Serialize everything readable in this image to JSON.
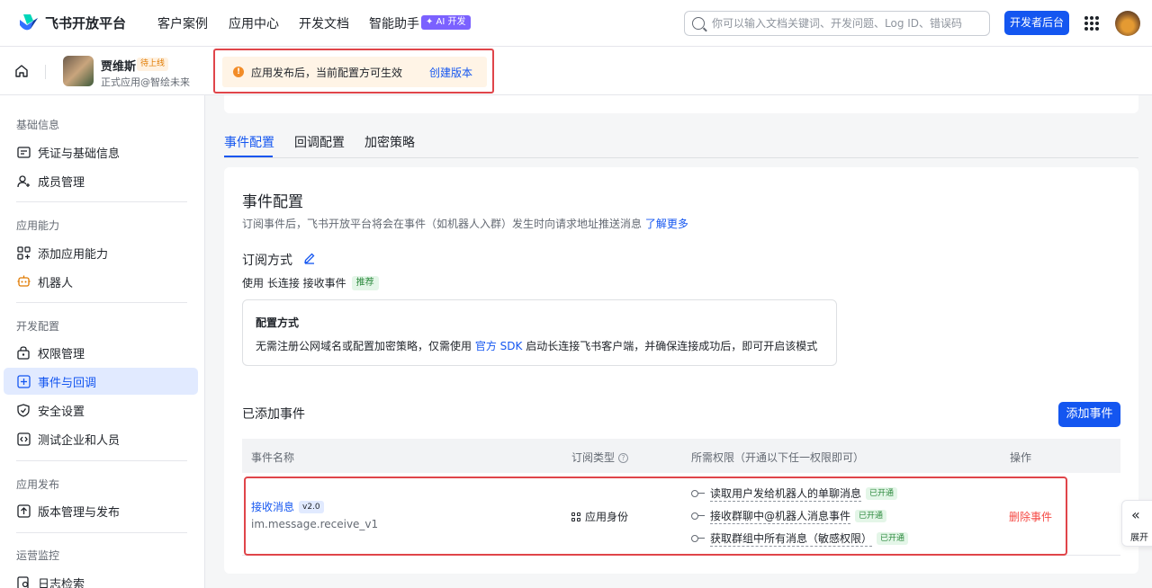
{
  "topnav": {
    "logo_text": "飞书开放平台",
    "items": [
      "客户案例",
      "应用中心",
      "开发文档",
      "智能助手"
    ],
    "ai_badge": "✦ AI 开发",
    "search_placeholder": "你可以输入文档关键词、开发问题、Log ID、错误码",
    "dev_console": "开发者后台"
  },
  "app": {
    "name": "贾维斯",
    "status": "待上线",
    "subtitle": "正式应用@智绘未来"
  },
  "notice": {
    "text": "应用发布后，当前配置方可生效",
    "link": "创建版本"
  },
  "sidebar": {
    "groups": [
      {
        "title": "基础信息",
        "items": [
          {
            "label": "凭证与基础信息",
            "icon": "id-card-icon"
          },
          {
            "label": "成员管理",
            "icon": "user-add-icon"
          }
        ]
      },
      {
        "title": "应用能力",
        "items": [
          {
            "label": "添加应用能力",
            "icon": "apps-add-icon"
          },
          {
            "label": "机器人",
            "icon": "robot-icon"
          }
        ]
      },
      {
        "title": "开发配置",
        "items": [
          {
            "label": "权限管理",
            "icon": "lock-icon"
          },
          {
            "label": "事件与回调",
            "icon": "event-icon"
          },
          {
            "label": "安全设置",
            "icon": "shield-icon"
          },
          {
            "label": "测试企业和人员",
            "icon": "code-icon"
          }
        ]
      },
      {
        "title": "应用发布",
        "items": [
          {
            "label": "版本管理与发布",
            "icon": "upload-icon"
          }
        ]
      },
      {
        "title": "运营监控",
        "items": [
          {
            "label": "日志检索",
            "icon": "search-doc-icon"
          }
        ]
      }
    ]
  },
  "tabs": [
    "事件配置",
    "回调配置",
    "加密策略"
  ],
  "event_config": {
    "title": "事件配置",
    "desc": "订阅事件后，飞书开放平台将会在事件（如机器人入群）发生时向请求地址推送消息",
    "learn_more": "了解更多",
    "subscribe_title": "订阅方式",
    "subscribe_line": "使用 长连接 接收事件",
    "recommend_tag": "推荐",
    "mode_title": "配置方式",
    "mode_text_pre": "无需注册公网域名或配置加密策略，仅需使用 ",
    "mode_text_link": "官方 SDK",
    "mode_text_post": " 启动长连接飞书客户端，并确保连接成功后，即可开启该模式"
  },
  "added_events": {
    "title": "已添加事件",
    "add_button": "添加事件",
    "columns": [
      "事件名称",
      "订阅类型",
      "所需权限（开通以下任一权限即可）",
      "操作"
    ],
    "rows": [
      {
        "name": "接收消息",
        "version": "v2.0",
        "code": "im.message.receive_v1",
        "type": "应用身份",
        "permissions": [
          {
            "text": "读取用户发给机器人的单聊消息",
            "status": "已开通"
          },
          {
            "text": "接收群聊中@机器人消息事件",
            "status": "已开通"
          },
          {
            "text": "获取群组中所有消息（敏感权限）",
            "status": "已开通"
          }
        ],
        "action": "删除事件"
      }
    ]
  },
  "expand": {
    "label": "展开"
  },
  "colors": {
    "primary": "#1456f0",
    "danger": "#f54a45",
    "highlight_frame": "#e0454a"
  }
}
